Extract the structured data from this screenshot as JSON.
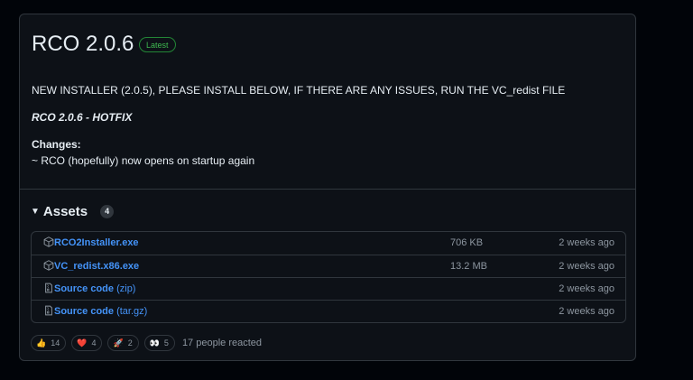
{
  "release": {
    "title": "RCO 2.0.6",
    "badge": "Latest",
    "notes_line": "NEW INSTALLER (2.0.5), PLEASE INSTALL BELOW, IF THERE ARE ANY ISSUES, RUN THE VC_redist FILE",
    "hotfix": "RCO 2.0.6 - HOTFIX",
    "changes_heading": "Changes:",
    "changes_item": "~ RCO (hopefully) now opens on startup again"
  },
  "assets": {
    "title": "Assets",
    "count": "4",
    "rows": [
      {
        "name": "RCO2Installer.exe",
        "suffix": "",
        "size": "706 KB",
        "date": "2 weeks ago",
        "icon": "package-icon"
      },
      {
        "name": "VC_redist.x86.exe",
        "suffix": "",
        "size": "13.2 MB",
        "date": "2 weeks ago",
        "icon": "package-icon"
      },
      {
        "name": "Source code",
        "suffix": " (zip)",
        "size": "",
        "date": "2 weeks ago",
        "icon": "file-zip-icon"
      },
      {
        "name": "Source code",
        "suffix": " (tar.gz)",
        "size": "",
        "date": "2 weeks ago",
        "icon": "file-zip-icon"
      }
    ]
  },
  "reactions": {
    "items": [
      {
        "emoji": "👍",
        "count": "14",
        "icon": "thumbs-up-icon"
      },
      {
        "emoji": "❤️",
        "count": "4",
        "icon": "heart-icon"
      },
      {
        "emoji": "🚀",
        "count": "2",
        "icon": "rocket-icon"
      },
      {
        "emoji": "👀",
        "count": "5",
        "icon": "eyes-icon"
      }
    ],
    "summary": "17 people reacted"
  }
}
